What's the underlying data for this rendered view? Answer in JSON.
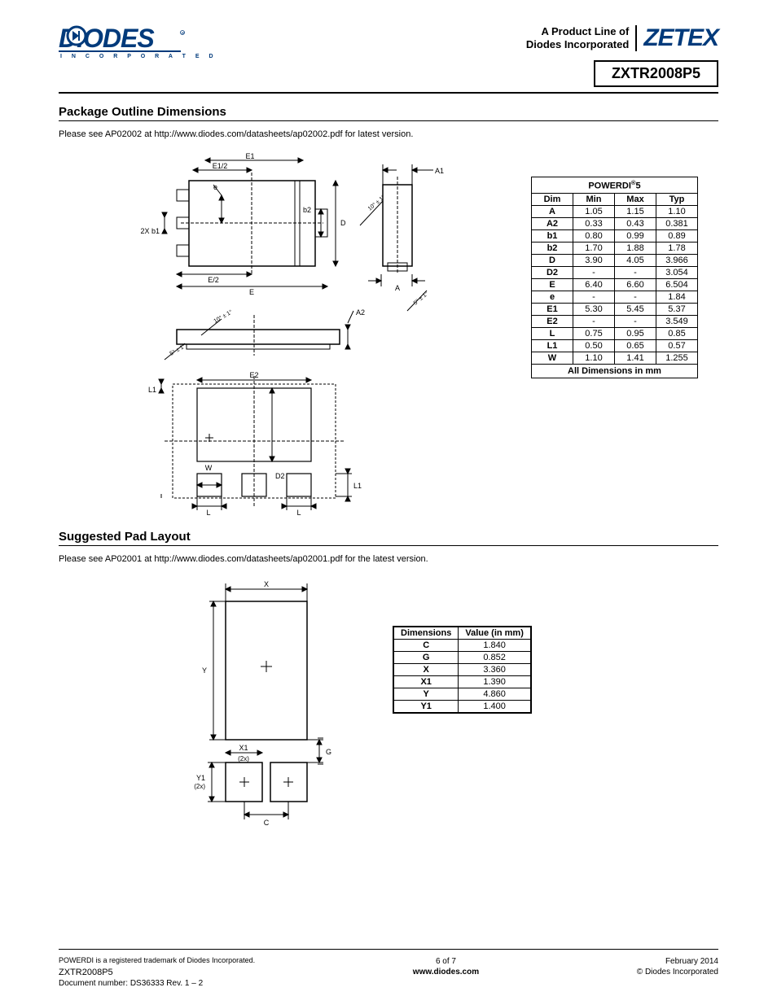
{
  "header": {
    "logo_text": "DIODES",
    "logo_sub": "I N C O R P O R A T E D",
    "tagline1": "A Product Line of",
    "tagline2": "Diodes Incorporated",
    "brand": "ZETEX",
    "part": "ZXTR2008P5"
  },
  "section1": {
    "title": "Package Outline Dimensions",
    "note": "Please see AP02002 at http://www.diodes.com/datasheets/ap02002.pdf for latest version."
  },
  "dim_table": {
    "title_prefix": "POWERDI",
    "title_suffix": "5",
    "headers": [
      "Dim",
      "Min",
      "Max",
      "Typ"
    ],
    "rows": [
      [
        "A",
        "1.05",
        "1.15",
        "1.10"
      ],
      [
        "A2",
        "0.33",
        "0.43",
        "0.381"
      ],
      [
        "b1",
        "0.80",
        "0.99",
        "0.89"
      ],
      [
        "b2",
        "1.70",
        "1.88",
        "1.78"
      ],
      [
        "D",
        "3.90",
        "4.05",
        "3.966"
      ],
      [
        "D2",
        "-",
        "-",
        "3.054"
      ],
      [
        "E",
        "6.40",
        "6.60",
        "6.504"
      ],
      [
        "e",
        "-",
        "-",
        "1.84"
      ],
      [
        "E1",
        "5.30",
        "5.45",
        "5.37"
      ],
      [
        "E2",
        "-",
        "-",
        "3.549"
      ],
      [
        "L",
        "0.75",
        "0.95",
        "0.85"
      ],
      [
        "L1",
        "0.50",
        "0.65",
        "0.57"
      ],
      [
        "W",
        "1.10",
        "1.41",
        "1.255"
      ]
    ],
    "footer": "All Dimensions in mm"
  },
  "drawing_labels": {
    "E1": "E1",
    "E1_2": "E1/2",
    "e": "e",
    "b2": "b2",
    "D": "D",
    "twoXb1": "2X b1",
    "E_2": "E/2",
    "E": "E",
    "A1": "A1",
    "A": "A",
    "A2": "A2",
    "ten": "10° ± 1°",
    "five": "5° ± 1°",
    "E2": "E2",
    "L1a": "L1",
    "L1b": "L1",
    "W": "W",
    "D2": "D2",
    "La": "L",
    "Lb": "L"
  },
  "section2": {
    "title": "Suggested Pad Layout",
    "note": "Please see AP02001 at http://www.diodes.com/datasheets/ap02001.pdf for the latest version."
  },
  "pad_labels": {
    "X": "X",
    "Y": "Y",
    "X1": "X1",
    "x2": "(2x)",
    "G": "G",
    "Y1": "Y1",
    "y2": "(2x)",
    "C": "C"
  },
  "pad_table": {
    "headers": [
      "Dimensions",
      "Value (in mm)"
    ],
    "rows": [
      [
        "C",
        "1.840"
      ],
      [
        "G",
        "0.852"
      ],
      [
        "X",
        "3.360"
      ],
      [
        "X1",
        "1.390"
      ],
      [
        "Y",
        "4.860"
      ],
      [
        "Y1",
        "1.400"
      ]
    ]
  },
  "footer": {
    "trademark": "POWERDI is a registered trademark of Diodes Incorporated.",
    "part": "ZXTR2008P5",
    "docnum": "Document number: DS36333 Rev. 1 – 2",
    "page": "6 of 7",
    "url": "www.diodes.com",
    "date": "February 2014",
    "copyright": "© Diodes Incorporated"
  }
}
